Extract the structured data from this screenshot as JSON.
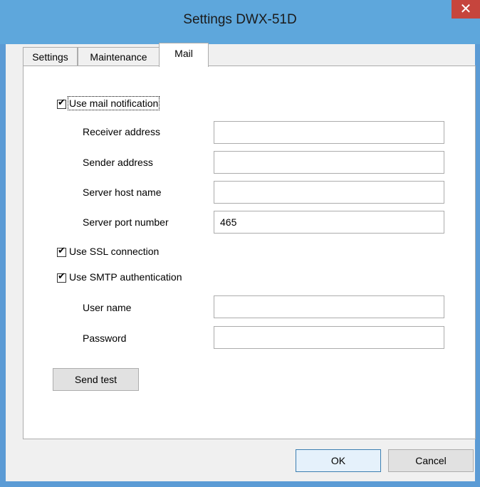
{
  "window": {
    "title": "Settings DWX-51D",
    "close_glyph": "✕"
  },
  "tabs": [
    {
      "label": "Settings",
      "active": false
    },
    {
      "label": "Maintenance",
      "active": false
    },
    {
      "label": "Mail",
      "active": true
    }
  ],
  "mail": {
    "use_mail_notification": {
      "label": "Use mail notification",
      "checked": true
    },
    "receiver_address": {
      "label": "Receiver address",
      "value": ""
    },
    "sender_address": {
      "label": "Sender address",
      "value": ""
    },
    "server_host_name": {
      "label": "Server host name",
      "value": ""
    },
    "server_port_number": {
      "label": "Server port number",
      "value": "465"
    },
    "use_ssl": {
      "label": "Use SSL connection",
      "checked": true
    },
    "use_smtp_auth": {
      "label": "Use SMTP authentication",
      "checked": true
    },
    "user_name": {
      "label": "User name",
      "value": ""
    },
    "password": {
      "label": "Password",
      "value": ""
    },
    "send_test_label": "Send test"
  },
  "footer": {
    "ok_label": "OK",
    "cancel_label": "Cancel"
  },
  "colors": {
    "titlebar": "#5ea7dc",
    "close": "#c6453d",
    "frame": "#5b9bd5",
    "dialog_bg": "#f0f0f0"
  }
}
